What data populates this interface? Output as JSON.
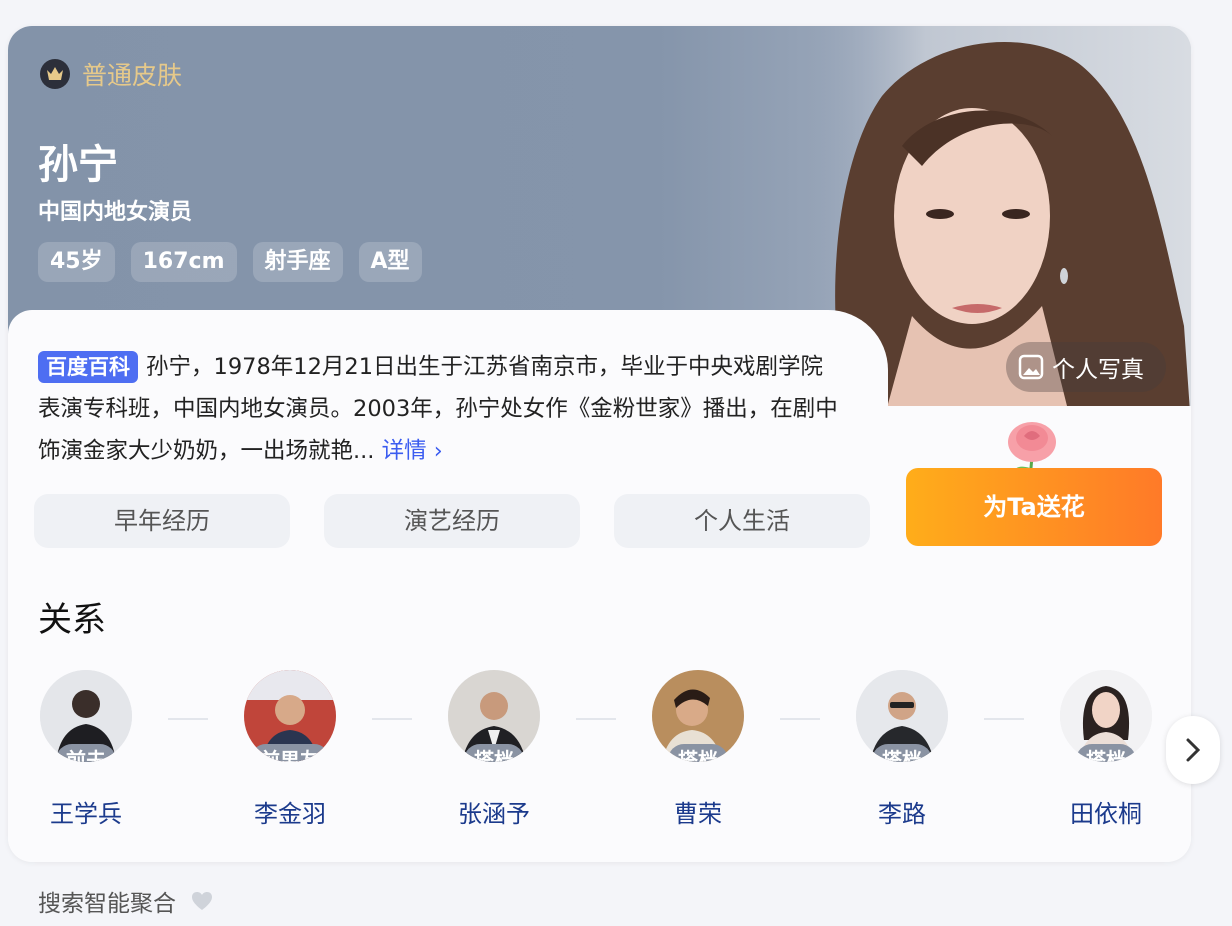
{
  "skin": {
    "label": "普通皮肤"
  },
  "profile": {
    "name": "孙宁",
    "subtitle": "中国内地女演员",
    "tags": [
      "45岁",
      "167cm",
      "射手座",
      "A型"
    ]
  },
  "photo_button": {
    "label": "个人写真"
  },
  "description": {
    "source_tag": "百度百科",
    "text": "孙宁，1978年12月21日出生于江苏省南京市，毕业于中央戏剧学院表演专科班，中国内地女演员。2003年，孙宁处女作《金粉世家》播出，在剧中饰演金家大少奶奶，一出场就艳...",
    "more": "详情 ›"
  },
  "sections": [
    "早年经历",
    "演艺经历",
    "个人生活"
  ],
  "flower_button": {
    "label": "为Ta送花"
  },
  "relations": {
    "title": "关系",
    "people": [
      {
        "name": "王学兵",
        "role": "前夫"
      },
      {
        "name": "李金羽",
        "role": "前男友"
      },
      {
        "name": "张涵予",
        "role": "搭档"
      },
      {
        "name": "曹荣",
        "role": "搭档"
      },
      {
        "name": "李路",
        "role": "搭档"
      },
      {
        "name": "田依桐",
        "role": "搭档"
      }
    ]
  },
  "footer": {
    "label": "搜索智能聚合"
  },
  "colors": {
    "accent": "#4e6ef2",
    "skin_gold": "#e6c98a",
    "flower_start": "#ffad1a",
    "flower_end": "#ff7a28",
    "hero_bg": "#8595ab"
  }
}
